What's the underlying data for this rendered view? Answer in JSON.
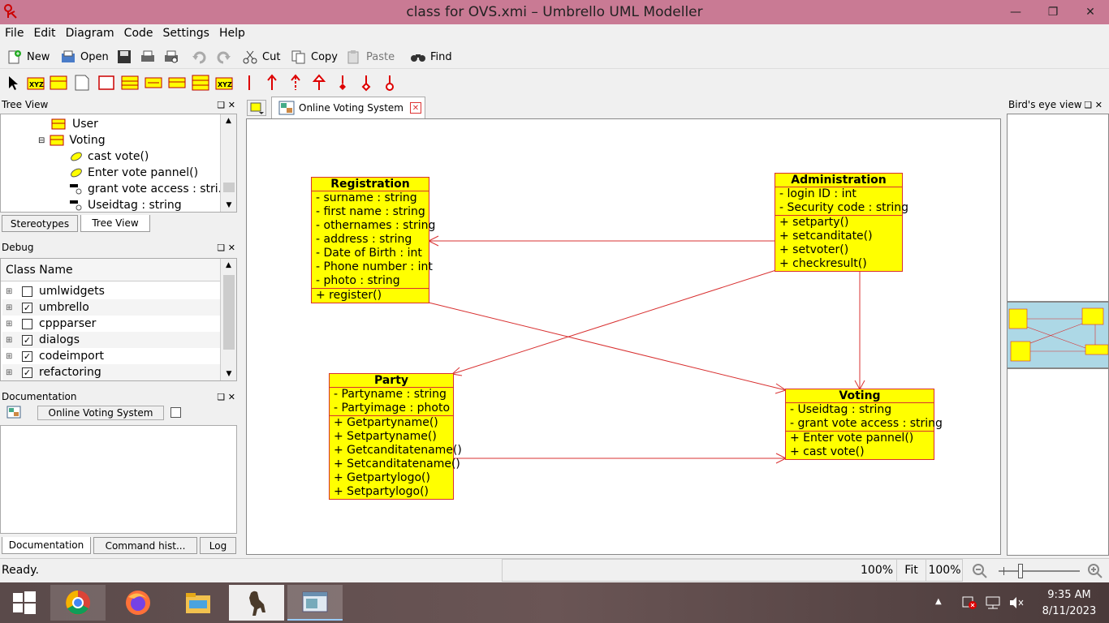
{
  "window": {
    "title": "class for OVS.xmi – Umbrello UML Modeller"
  },
  "menu": [
    "File",
    "Edit",
    "Diagram",
    "Code",
    "Settings",
    "Help"
  ],
  "toolbar": {
    "new": "New",
    "open": "Open",
    "cut": "Cut",
    "copy": "Copy",
    "paste": "Paste",
    "find": "Find"
  },
  "tree_view": {
    "title": "Tree View",
    "items": [
      {
        "label": "User",
        "icon": "class-icon"
      },
      {
        "label": "Voting",
        "icon": "class-icon"
      },
      {
        "label": "cast vote()",
        "icon": "operation-icon"
      },
      {
        "label": "Enter vote pannel()",
        "icon": "operation-icon"
      },
      {
        "label": "grant vote access : stri...",
        "icon": "attribute-icon"
      },
      {
        "label": "Useidtag : string",
        "icon": "attribute-icon"
      }
    ],
    "tabs": [
      "Stereotypes",
      "Tree View"
    ]
  },
  "debug": {
    "title": "Debug",
    "column": "Class Name",
    "rows": [
      {
        "label": "umlwidgets",
        "checked": false
      },
      {
        "label": "umbrello",
        "checked": true
      },
      {
        "label": "cppparser",
        "checked": false
      },
      {
        "label": "dialogs",
        "checked": true
      },
      {
        "label": "codeimport",
        "checked": true
      },
      {
        "label": "refactoring",
        "checked": true
      }
    ]
  },
  "documentation": {
    "title": "Documentation",
    "field": "Online Voting System",
    "tabs": [
      "Documentation",
      "Command hist...",
      "Log"
    ]
  },
  "diagram": {
    "tab": "Online Voting System",
    "classes": {
      "registration": {
        "name": "Registration",
        "attributes": [
          "- surname : string",
          "- first name : string",
          "- othernames : string",
          "- address : string",
          "- Date of Birth : int",
          "- Phone number : int",
          "- photo : string"
        ],
        "operations": [
          "+ register()"
        ]
      },
      "administration": {
        "name": "Administration",
        "attributes": [
          "- login ID : int",
          "- Security code : string"
        ],
        "operations": [
          "+ setparty()",
          "+ setcanditate()",
          "+ setvoter()",
          "+ checkresult()"
        ]
      },
      "party": {
        "name": "Party",
        "attributes": [
          "- Partyname : string",
          "- Partyimage : photo"
        ],
        "operations": [
          "+ Getpartyname()",
          "+ Setpartyname()",
          "+ Getcanditatename()",
          "+ Setcanditatename()",
          "+ Getpartylogo()",
          "+ Setpartylogo()"
        ]
      },
      "voting": {
        "name": "Voting",
        "attributes": [
          "- Useidtag : string",
          "- grant vote access : string"
        ],
        "operations": [
          "+ Enter vote pannel()",
          "+ cast vote()"
        ]
      }
    },
    "colors": {
      "class_fill": "#ffff00",
      "line": "#d83030"
    }
  },
  "birds_eye": {
    "title": "Bird's eye view"
  },
  "status": {
    "text": "Ready.",
    "zoom1": "100%",
    "fit": "Fit",
    "zoom2": "100%"
  },
  "taskbar": {
    "time": "9:35 AM",
    "date": "8/11/2023"
  }
}
